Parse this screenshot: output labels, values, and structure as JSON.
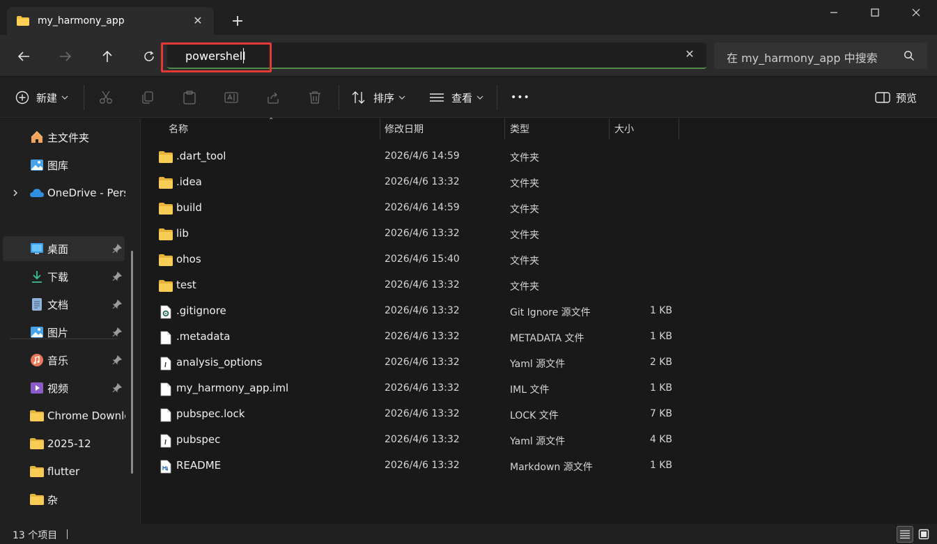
{
  "tab": {
    "title": "my_harmony_app"
  },
  "address": {
    "value": "powershell"
  },
  "search": {
    "placeholder": "在 my_harmony_app 中搜索"
  },
  "toolbar": {
    "new_label": "新建",
    "sort_label": "排序",
    "view_label": "查看",
    "more_label": "•••",
    "preview_label": "预览"
  },
  "sidebar": {
    "items": [
      {
        "label": "主文件夹",
        "icon": "home-icon"
      },
      {
        "label": "图库",
        "icon": "gallery-icon"
      },
      {
        "label": "OneDrive - Personal",
        "icon": "onedrive-icon"
      },
      {
        "label": "桌面",
        "icon": "desktop-icon"
      },
      {
        "label": "下载",
        "icon": "download-icon"
      },
      {
        "label": "文档",
        "icon": "document-icon"
      },
      {
        "label": "图片",
        "icon": "pictures-icon"
      },
      {
        "label": "音乐",
        "icon": "music-icon"
      },
      {
        "label": "视频",
        "icon": "video-icon"
      },
      {
        "label": "Chrome Downloads",
        "icon": "folder-icon"
      },
      {
        "label": "2025-12",
        "icon": "folder-icon"
      },
      {
        "label": "flutter",
        "icon": "folder-icon"
      },
      {
        "label": "杂",
        "icon": "folder-icon"
      }
    ]
  },
  "columns": {
    "name": "名称",
    "date": "修改日期",
    "type": "类型",
    "size": "大小"
  },
  "files": [
    {
      "name": ".dart_tool",
      "date": "2026/4/6 14:59",
      "type": "文件夹",
      "size": "",
      "kind": "folder"
    },
    {
      "name": ".idea",
      "date": "2026/4/6 13:32",
      "type": "文件夹",
      "size": "",
      "kind": "folder"
    },
    {
      "name": "build",
      "date": "2026/4/6 14:59",
      "type": "文件夹",
      "size": "",
      "kind": "folder"
    },
    {
      "name": "lib",
      "date": "2026/4/6 13:32",
      "type": "文件夹",
      "size": "",
      "kind": "folder"
    },
    {
      "name": "ohos",
      "date": "2026/4/6 15:40",
      "type": "文件夹",
      "size": "",
      "kind": "folder"
    },
    {
      "name": "test",
      "date": "2026/4/6 13:32",
      "type": "文件夹",
      "size": "",
      "kind": "folder"
    },
    {
      "name": ".gitignore",
      "date": "2026/4/6 13:32",
      "type": "Git Ignore 源文件",
      "size": "1 KB",
      "kind": "gear"
    },
    {
      "name": ".metadata",
      "date": "2026/4/6 13:32",
      "type": "METADATA 文件",
      "size": "1 KB",
      "kind": "file"
    },
    {
      "name": "analysis_options",
      "date": "2026/4/6 13:32",
      "type": "Yaml 源文件",
      "size": "2 KB",
      "kind": "yaml"
    },
    {
      "name": "my_harmony_app.iml",
      "date": "2026/4/6 13:32",
      "type": "IML 文件",
      "size": "1 KB",
      "kind": "file"
    },
    {
      "name": "pubspec.lock",
      "date": "2026/4/6 13:32",
      "type": "LOCK 文件",
      "size": "7 KB",
      "kind": "file"
    },
    {
      "name": "pubspec",
      "date": "2026/4/6 13:32",
      "type": "Yaml 源文件",
      "size": "4 KB",
      "kind": "yaml"
    },
    {
      "name": "README",
      "date": "2026/4/6 13:32",
      "type": "Markdown 源文件",
      "size": "1 KB",
      "kind": "markdown"
    }
  ],
  "status": {
    "count": "13 个项目"
  },
  "colors": {
    "accent": "#4f8a4a",
    "highlight_box": "#e53935",
    "folder": "#f5c342"
  }
}
